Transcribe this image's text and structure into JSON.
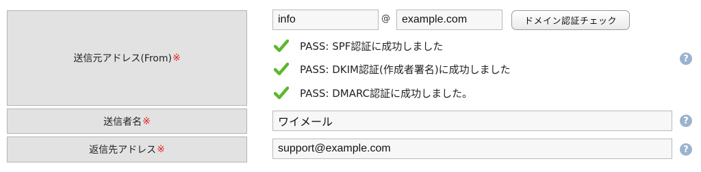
{
  "from_row": {
    "label": "送信元アドレス(From)",
    "required_mark": "※",
    "local_part": "info",
    "at_sign": "@",
    "domain": "example.com",
    "check_button": "ドメイン認証チェック",
    "results": [
      "PASS: SPF認証に成功しました",
      "PASS: DKIM認証(作成者署名)に成功しました",
      "PASS: DMARC認証に成功しました。"
    ],
    "help": "?"
  },
  "sender_name_row": {
    "label": "送信者名",
    "required_mark": "※",
    "value": "ワイメール",
    "help": "?"
  },
  "reply_to_row": {
    "label": "返信先アドレス",
    "required_mark": "※",
    "value": "support@example.com",
    "help": "?"
  },
  "colors": {
    "label_bg": "#e2e2e2",
    "required": "#e22222",
    "check_green": "#5cb82e",
    "help_icon": "#9ab3cf"
  }
}
